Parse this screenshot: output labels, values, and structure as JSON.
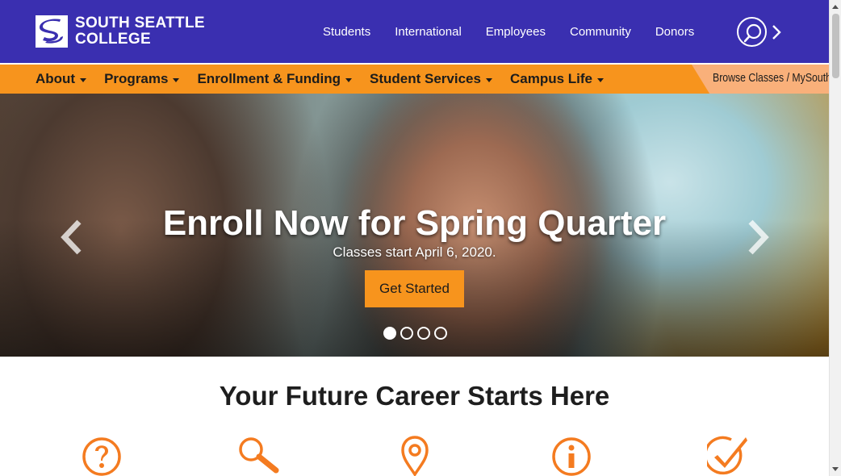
{
  "logo": {
    "line1": "SOUTH SEATTLE",
    "line2": "COLLEGE"
  },
  "top_nav": [
    "Students",
    "International",
    "Employees",
    "Community",
    "Donors"
  ],
  "icons": {
    "search": "search-icon",
    "more": "chevron-right-icon"
  },
  "main_nav": [
    "About",
    "Programs",
    "Enrollment & Funding",
    "Student Services",
    "Campus Life"
  ],
  "browse_link": "Browse Classes / MySouth",
  "hero": {
    "title": "Enroll Now for Spring Quarter",
    "subtitle": "Classes start April 6, 2020.",
    "cta": "Get Started",
    "slides": 4,
    "active_slide": 1
  },
  "section": {
    "heading": "Your Future Career Starts Here",
    "icon_names": [
      "question-icon",
      "search-icon",
      "location-pin-icon",
      "info-icon",
      "checkmark-icon"
    ]
  },
  "colors": {
    "brand_purple": "#3a2fb0",
    "brand_orange": "#f7941d"
  }
}
